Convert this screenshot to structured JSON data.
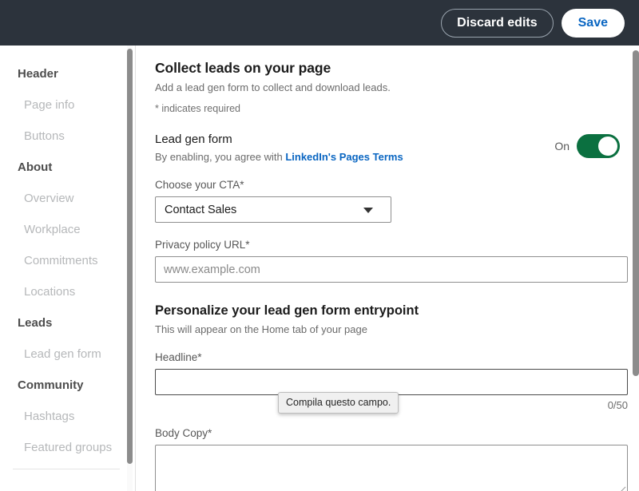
{
  "topbar": {
    "discard_label": "Discard edits",
    "save_label": "Save",
    "background_color": "#2c333c",
    "save_text_color": "#0a66c2"
  },
  "sidebar": {
    "items": [
      {
        "label": "Header",
        "type": "group"
      },
      {
        "label": "Page info",
        "type": "item"
      },
      {
        "label": "Buttons",
        "type": "item"
      },
      {
        "label": "About",
        "type": "group"
      },
      {
        "label": "Overview",
        "type": "item"
      },
      {
        "label": "Workplace",
        "type": "item"
      },
      {
        "label": "Commitments",
        "type": "item"
      },
      {
        "label": "Locations",
        "type": "item"
      },
      {
        "label": "Leads",
        "type": "group"
      },
      {
        "label": "Lead gen form",
        "type": "item"
      },
      {
        "label": "Community",
        "type": "group"
      },
      {
        "label": "Hashtags",
        "type": "item"
      },
      {
        "label": "Featured groups",
        "type": "item"
      }
    ]
  },
  "main": {
    "title": "Collect leads on your page",
    "subtitle": "Add a lead gen form to collect and download leads.",
    "required_note": "* indicates required",
    "lead_gen": {
      "label": "Lead gen form",
      "agreement_prefix": "By enabling, you agree with ",
      "agreement_link": "LinkedIn's Pages Terms",
      "toggle_state": "On",
      "toggle_on": true,
      "toggle_color": "#0b7040"
    },
    "cta": {
      "label": "Choose your CTA*",
      "value": "Contact Sales",
      "options": [
        "Contact Sales"
      ]
    },
    "privacy": {
      "label": "Privacy policy URL*",
      "value": "",
      "placeholder": "www.example.com"
    },
    "personalize": {
      "title": "Personalize your lead gen form entrypoint",
      "subtitle": "This will appear on the Home tab of your page"
    },
    "headline": {
      "label": "Headline*",
      "value": "",
      "placeholder": "",
      "counter": "0/50"
    },
    "body_copy": {
      "label": "Body Copy*",
      "value": "",
      "placeholder": ""
    },
    "validation_tooltip": "Compila questo campo."
  }
}
